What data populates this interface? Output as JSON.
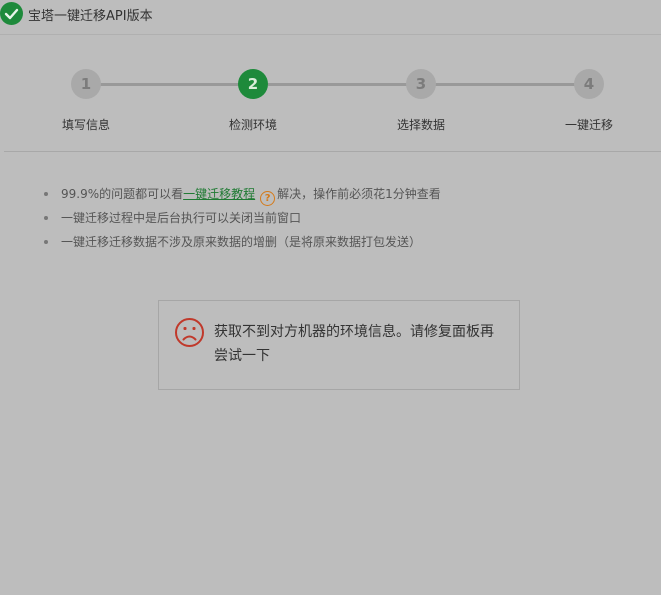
{
  "window": {
    "title": "宝塔一键迁移API版本",
    "title_icon": "check-circle-icon"
  },
  "steps": [
    {
      "number": "1",
      "label": "填写信息",
      "state": "pending"
    },
    {
      "number": "2",
      "label": "检测环境",
      "state": "active"
    },
    {
      "number": "3",
      "label": "选择数据",
      "state": "pending"
    },
    {
      "number": "4",
      "label": "一键迁移",
      "state": "pending"
    }
  ],
  "tips": {
    "item1_before": "99.9%的问题都可以看",
    "item1_link": "一键迁移教程",
    "item1_icon": "help-icon",
    "item1_after": "解决，操作前必须花1分钟查看",
    "item2": "一键迁移过程中是后台执行可以关闭当前窗口",
    "item3": "一键迁移迁移数据不涉及原来数据的增删（是将原来数据打包发送）"
  },
  "error": {
    "icon": "sad-face-icon",
    "message": "获取不到对方机器的环境信息。请修复面板再尝试一下"
  },
  "colors": {
    "background": "#bdbdbd",
    "accent": "#1e8a3b",
    "link": "#1f7a33",
    "warning": "#d47a1a",
    "error_icon": "#c0392b"
  }
}
